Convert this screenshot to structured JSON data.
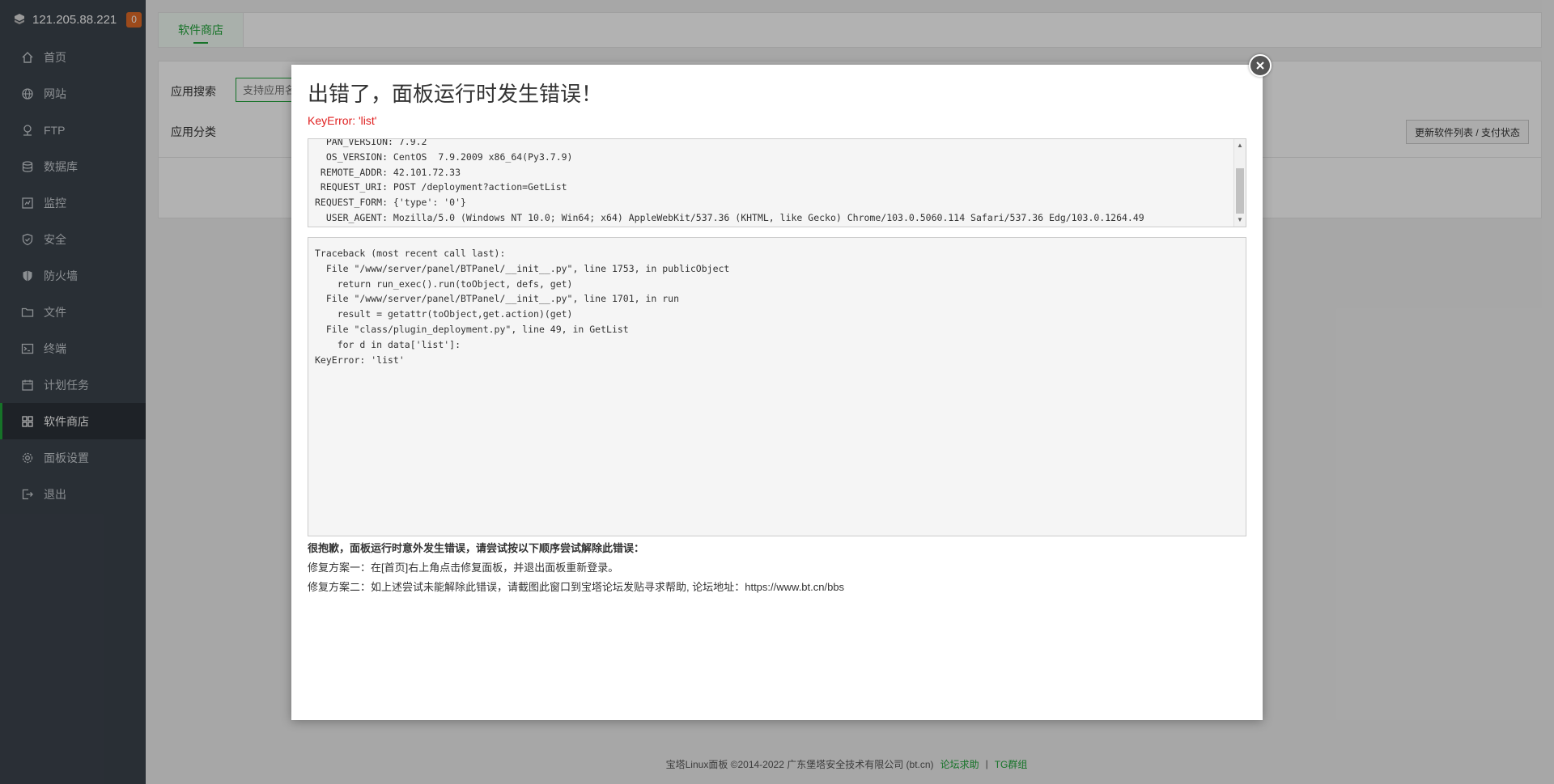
{
  "sidebar": {
    "server_ip": "121.205.88.221",
    "badge": "0",
    "items": [
      {
        "label": "首页",
        "icon": "home-icon"
      },
      {
        "label": "网站",
        "icon": "globe-icon"
      },
      {
        "label": "FTP",
        "icon": "ftp-icon"
      },
      {
        "label": "数据库",
        "icon": "database-icon"
      },
      {
        "label": "监控",
        "icon": "monitor-icon"
      },
      {
        "label": "安全",
        "icon": "shield-icon"
      },
      {
        "label": "防火墙",
        "icon": "firewall-icon"
      },
      {
        "label": "文件",
        "icon": "folder-icon"
      },
      {
        "label": "终端",
        "icon": "terminal-icon"
      },
      {
        "label": "计划任务",
        "icon": "calendar-icon"
      },
      {
        "label": "软件商店",
        "icon": "grid-icon",
        "active": true
      },
      {
        "label": "面板设置",
        "icon": "gear-icon"
      },
      {
        "label": "退出",
        "icon": "logout-icon"
      }
    ]
  },
  "main": {
    "tab": "软件商店",
    "search_label": "应用搜索",
    "search_placeholder": "支持应用名",
    "category_label": "应用分类",
    "refresh_button": "更新软件列表 / 支付状态"
  },
  "footer": {
    "copyright": "宝塔Linux面板 ©2014-2022 广东堡塔安全技术有限公司 (bt.cn)",
    "forum_link": "论坛求助",
    "separator": "|",
    "tg_link": "TG群组"
  },
  "dialog": {
    "title": "出错了，面板运行时发生错误！",
    "error": "KeyError: 'list'",
    "env_text": "  PAN_VERSION: 7.9.2\n  OS_VERSION: CentOS  7.9.2009 x86_64(Py3.7.9)\n REMOTE_ADDR: 42.101.72.33\n REQUEST_URI: POST /deployment?action=GetList\nREQUEST_FORM: {'type': '0'}\n  USER_AGENT: Mozilla/5.0 (Windows NT 10.0; Win64; x64) AppleWebKit/537.36 (KHTML, like Gecko) Chrome/103.0.5060.114 Safari/537.36 Edg/103.0.1264.49",
    "traceback": "Traceback (most recent call last):\n  File \"/www/server/panel/BTPanel/__init__.py\", line 1753, in publicObject\n    return run_exec().run(toObject, defs, get)\n  File \"/www/server/panel/BTPanel/__init__.py\", line 1701, in run\n    result = getattr(toObject,get.action)(get)\n  File \"class/plugin_deployment.py\", line 49, in GetList\n    for d in data['list']:\nKeyError: 'list'",
    "help_title": "很抱歉，面板运行时意外发生错误，请尝试按以下顺序尝试解除此错误：",
    "fix1": "修复方案一：在[首页]右上角点击修复面板，并退出面板重新登录。",
    "fix2": "修复方案二：如上述尝试未能解除此错误，请截图此窗口到宝塔论坛发贴寻求帮助, 论坛地址：https://www.bt.cn/bbs"
  }
}
